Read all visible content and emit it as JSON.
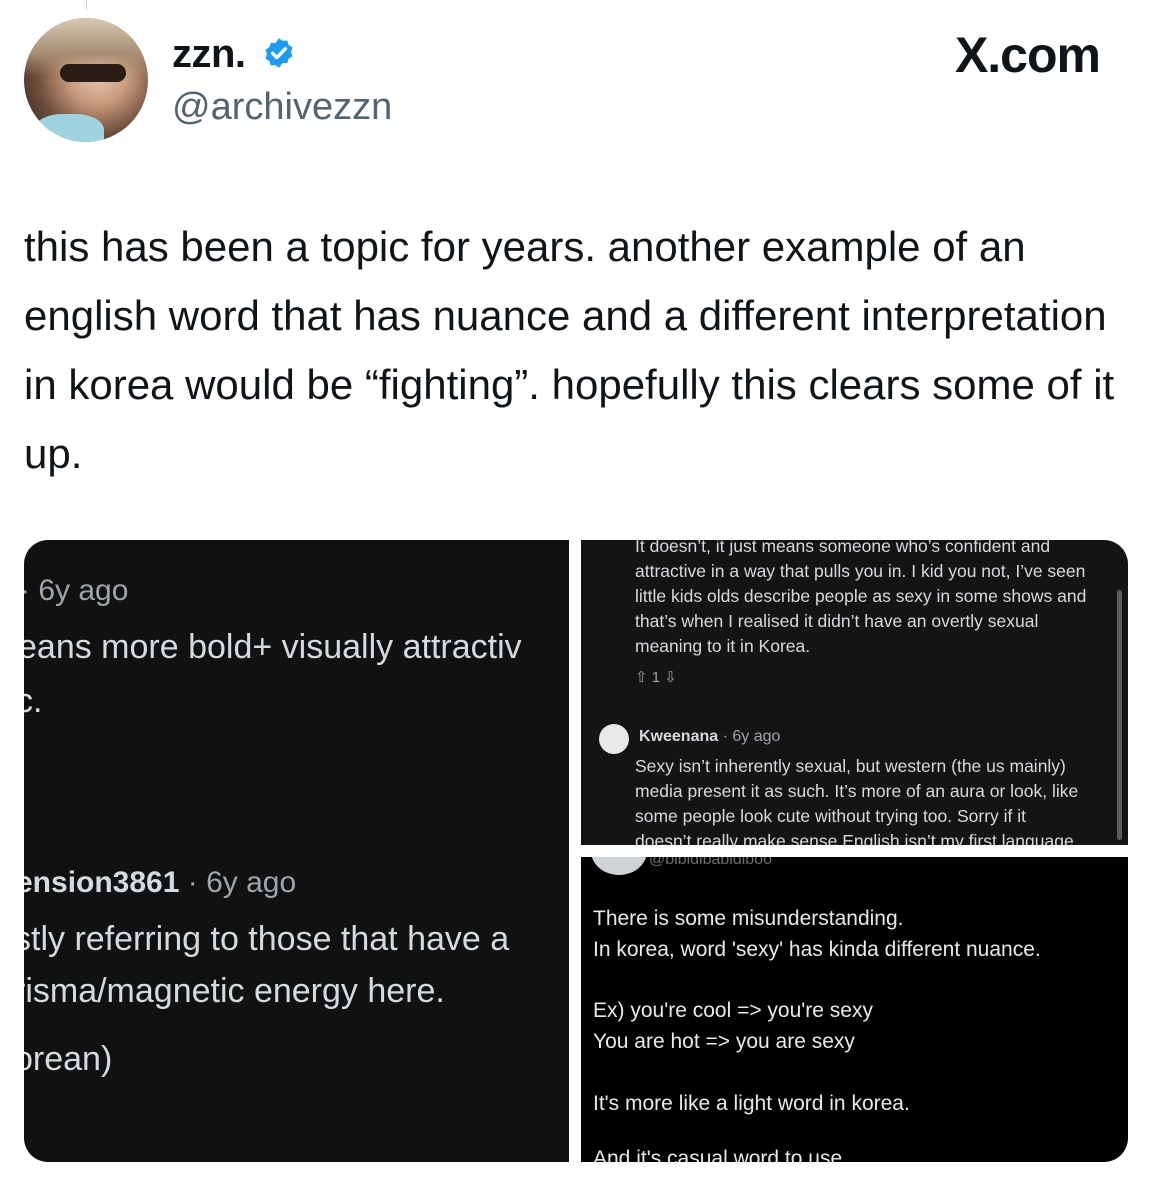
{
  "tweet": {
    "display_name": "zzn.",
    "handle": "@archivezzn",
    "brand": "X.com",
    "text": "this has been a topic for years. another example of an english word that has nuance and a different interpretation in korea would be “fighting”. hopefully this clears some of it up."
  },
  "left_panel": {
    "meta_1": "· 6y ago",
    "body_1": "eans more bold+ visually attractiv",
    "body_2": "c.",
    "user_2": "ension3861",
    "time_2": " · 6y ago",
    "body_3": "stly referring to those that have a",
    "body_4": "risma/magnetic energy here.",
    "body_5": "orean)"
  },
  "top_right_panel": {
    "lines": [
      "It doesn’t, it just means someone who’s confident and",
      "attractive in a way that pulls you in. I kid you not, I’ve seen",
      "little kids olds describe people as sexy in some shows and",
      "that’s when I realised it didn’t have an overtly sexual",
      "meaning to it in Korea."
    ],
    "votes": "⇧ 1 ⇩",
    "user": "Kweenana",
    "time": " · 6y ago",
    "reply_lines": [
      "Sexy isn’t inherently sexual, but western (the us mainly)",
      "media present it as such. It’s more of an aura or look, like",
      "some people look cute without trying too. Sorry if it",
      "doesn’t really make sense English isn’t my first language."
    ]
  },
  "bottom_right_panel": {
    "handle": "@bibidibabidiboo",
    "lines": [
      "There is some misunderstanding.",
      "In korea, word 'sexy' has kinda different nuance.",
      "Ex) you're cool => you're sexy",
      "You are hot => you are sexy",
      "It's more like a light word in korea."
    ],
    "cut_line": "And it's casual word to use"
  },
  "colors": {
    "verified": "#1d9bf0",
    "panel_dark": "#101113"
  }
}
